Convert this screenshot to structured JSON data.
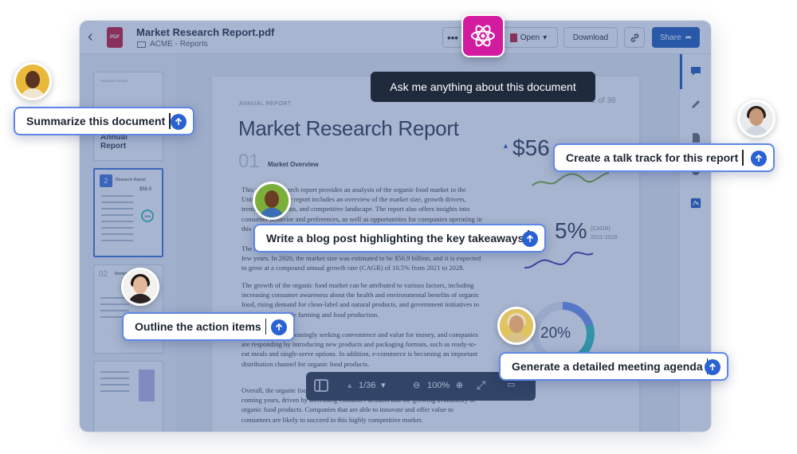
{
  "toolbar": {
    "file_name": "Market Research Report.pdf",
    "breadcrumb": "ACME - Reports",
    "pdf_badge": "PDF",
    "more_label": "•••",
    "open_label": "Open",
    "download_label": "Download",
    "share_label": "Share"
  },
  "ai": {
    "tooltip": "Ask me anything about this document"
  },
  "thumbnails": [
    {
      "title": "ORGANIC FOODS",
      "text": "Annual Report"
    },
    {
      "number": "2",
      "title": "Research Report",
      "stat": "$56.9",
      "pct": "10%"
    },
    {
      "number": "02",
      "title": "Market"
    },
    {
      "number": ""
    }
  ],
  "document": {
    "kicker": "ANNUAL REPORT",
    "page_of": "2 of 36",
    "title": "Market Research Report",
    "section_number": "01",
    "section_title": "Market Overview",
    "para1": "This market research report provides an analysis of the organic food market in the United States. The report includes an overview of the market size, growth drivers, trends and forecasts, and competitive landscape. The report also offers insights into consumer behavior and preferences, as well as opportunities for companies operating in this market.",
    "para2": "The organic food market in the United States has been growing steadily over the past few years. In 2020, the market size was estimated to be $56.9 billion, and it is expected to grow at a compound annual growth rate (CAGR) of 10.5% from 2021 to 2028.",
    "para3": "The growth of the organic food market can be attributed to various factors, including increasing consumer awareness about the health and environmental benefits of organic food, rising demand for clean-label and natural products, and government initiatives to promote sustainable farming and food production.",
    "para4": "Consumers are increasingly seeking convenience and value for money, and companies are responding by introducing new products and packaging formats, such as ready-to-eat meals and single-serve options. In addition, e-commerce is becoming an important distribution channel for organic food products.",
    "para5": "Overall, the organic food market is expected to continue its growth trajectory in the coming years, driven by increasing consumer demand and the growing availability of organic food products. Companies that are able to innovate and offer value to consumers are likely to succeed in this highly competitive market.",
    "stat1": "$56",
    "stat2": "5%",
    "cagr_label": "(CAGR)",
    "cagr_years": "2021-2028",
    "donut_pct": "20%"
  },
  "viewer": {
    "page_indicator": "1/36",
    "zoom": "100%"
  },
  "prompts": {
    "summarize": "Summarize this document",
    "talk_track": "Create a talk track for this report",
    "blog_post": "Write a blog post highlighting the key takeaways",
    "action_items": "Outline the action items",
    "meeting_agenda": "Generate a detailed meeting agenda"
  },
  "colors": {
    "accent": "#1a56b8",
    "ai_brand": "#d31ba0",
    "tooltip_bg": "#1f2a3d",
    "bubble_border": "#5f87e6",
    "send_button": "#2a62d4"
  }
}
